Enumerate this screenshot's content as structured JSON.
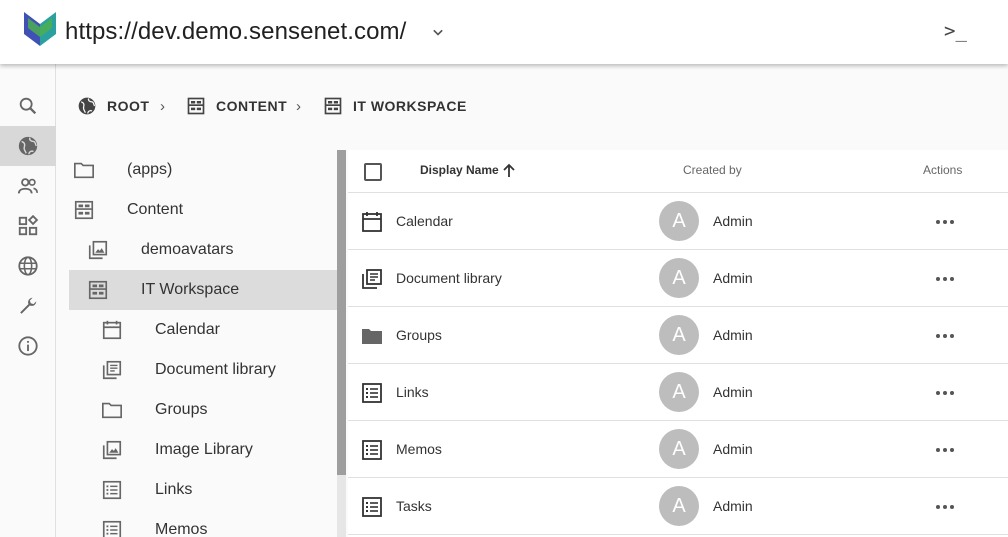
{
  "header": {
    "repository_url": "https://dev.demo.sensenet.com/",
    "command_prompt": ">_"
  },
  "colors": {
    "logo_teal": "#2aa0a0",
    "logo_green": "#4caf50",
    "logo_blue": "#3f51b5",
    "selected_bg": "#dcdcdc",
    "avatar_bg": "#bdbdbd"
  },
  "rail": [
    {
      "icon": "search-icon",
      "active": false
    },
    {
      "icon": "globe-icon",
      "active": true
    },
    {
      "icon": "users-icon",
      "active": false
    },
    {
      "icon": "widgets-icon",
      "active": false
    },
    {
      "icon": "language-icon",
      "active": false
    },
    {
      "icon": "wrench-icon",
      "active": false
    },
    {
      "icon": "info-icon",
      "active": false
    }
  ],
  "breadcrumb": [
    {
      "label": "ROOT",
      "icon": "public-icon"
    },
    {
      "label": "CONTENT",
      "icon": "workspace-icon"
    },
    {
      "label": "IT WORKSPACE",
      "icon": "workspace-icon"
    }
  ],
  "tree": [
    {
      "label": "(apps)",
      "icon": "folder-icon",
      "level": 0
    },
    {
      "label": "Content",
      "icon": "workspace-icon",
      "level": 0
    },
    {
      "label": "demoavatars",
      "icon": "image-library-icon",
      "level": 1
    },
    {
      "label": "IT Workspace",
      "icon": "workspace-icon",
      "level": 1,
      "selected": true
    },
    {
      "label": "Calendar",
      "icon": "calendar-icon",
      "level": 2
    },
    {
      "label": "Document library",
      "icon": "document-library-icon",
      "level": 2
    },
    {
      "label": "Groups",
      "icon": "folder-icon",
      "level": 2
    },
    {
      "label": "Image Library",
      "icon": "image-library-icon",
      "level": 2
    },
    {
      "label": "Links",
      "icon": "list-icon",
      "level": 2
    },
    {
      "label": "Memos",
      "icon": "list-icon",
      "level": 2
    }
  ],
  "grid": {
    "columns": {
      "display_name": "Display Name",
      "created_by": "Created by",
      "actions": "Actions"
    },
    "sort": "ascending",
    "rows": [
      {
        "name": "Calendar",
        "icon": "calendar-icon",
        "avatar": "A",
        "created_by": "Admin"
      },
      {
        "name": "Document library",
        "icon": "document-library-icon",
        "avatar": "A",
        "created_by": "Admin"
      },
      {
        "name": "Groups",
        "icon": "folder-icon",
        "avatar": "A",
        "created_by": "Admin"
      },
      {
        "name": "Links",
        "icon": "list-icon",
        "avatar": "A",
        "created_by": "Admin"
      },
      {
        "name": "Memos",
        "icon": "list-icon",
        "avatar": "A",
        "created_by": "Admin"
      },
      {
        "name": "Tasks",
        "icon": "list-icon",
        "avatar": "A",
        "created_by": "Admin"
      }
    ]
  }
}
